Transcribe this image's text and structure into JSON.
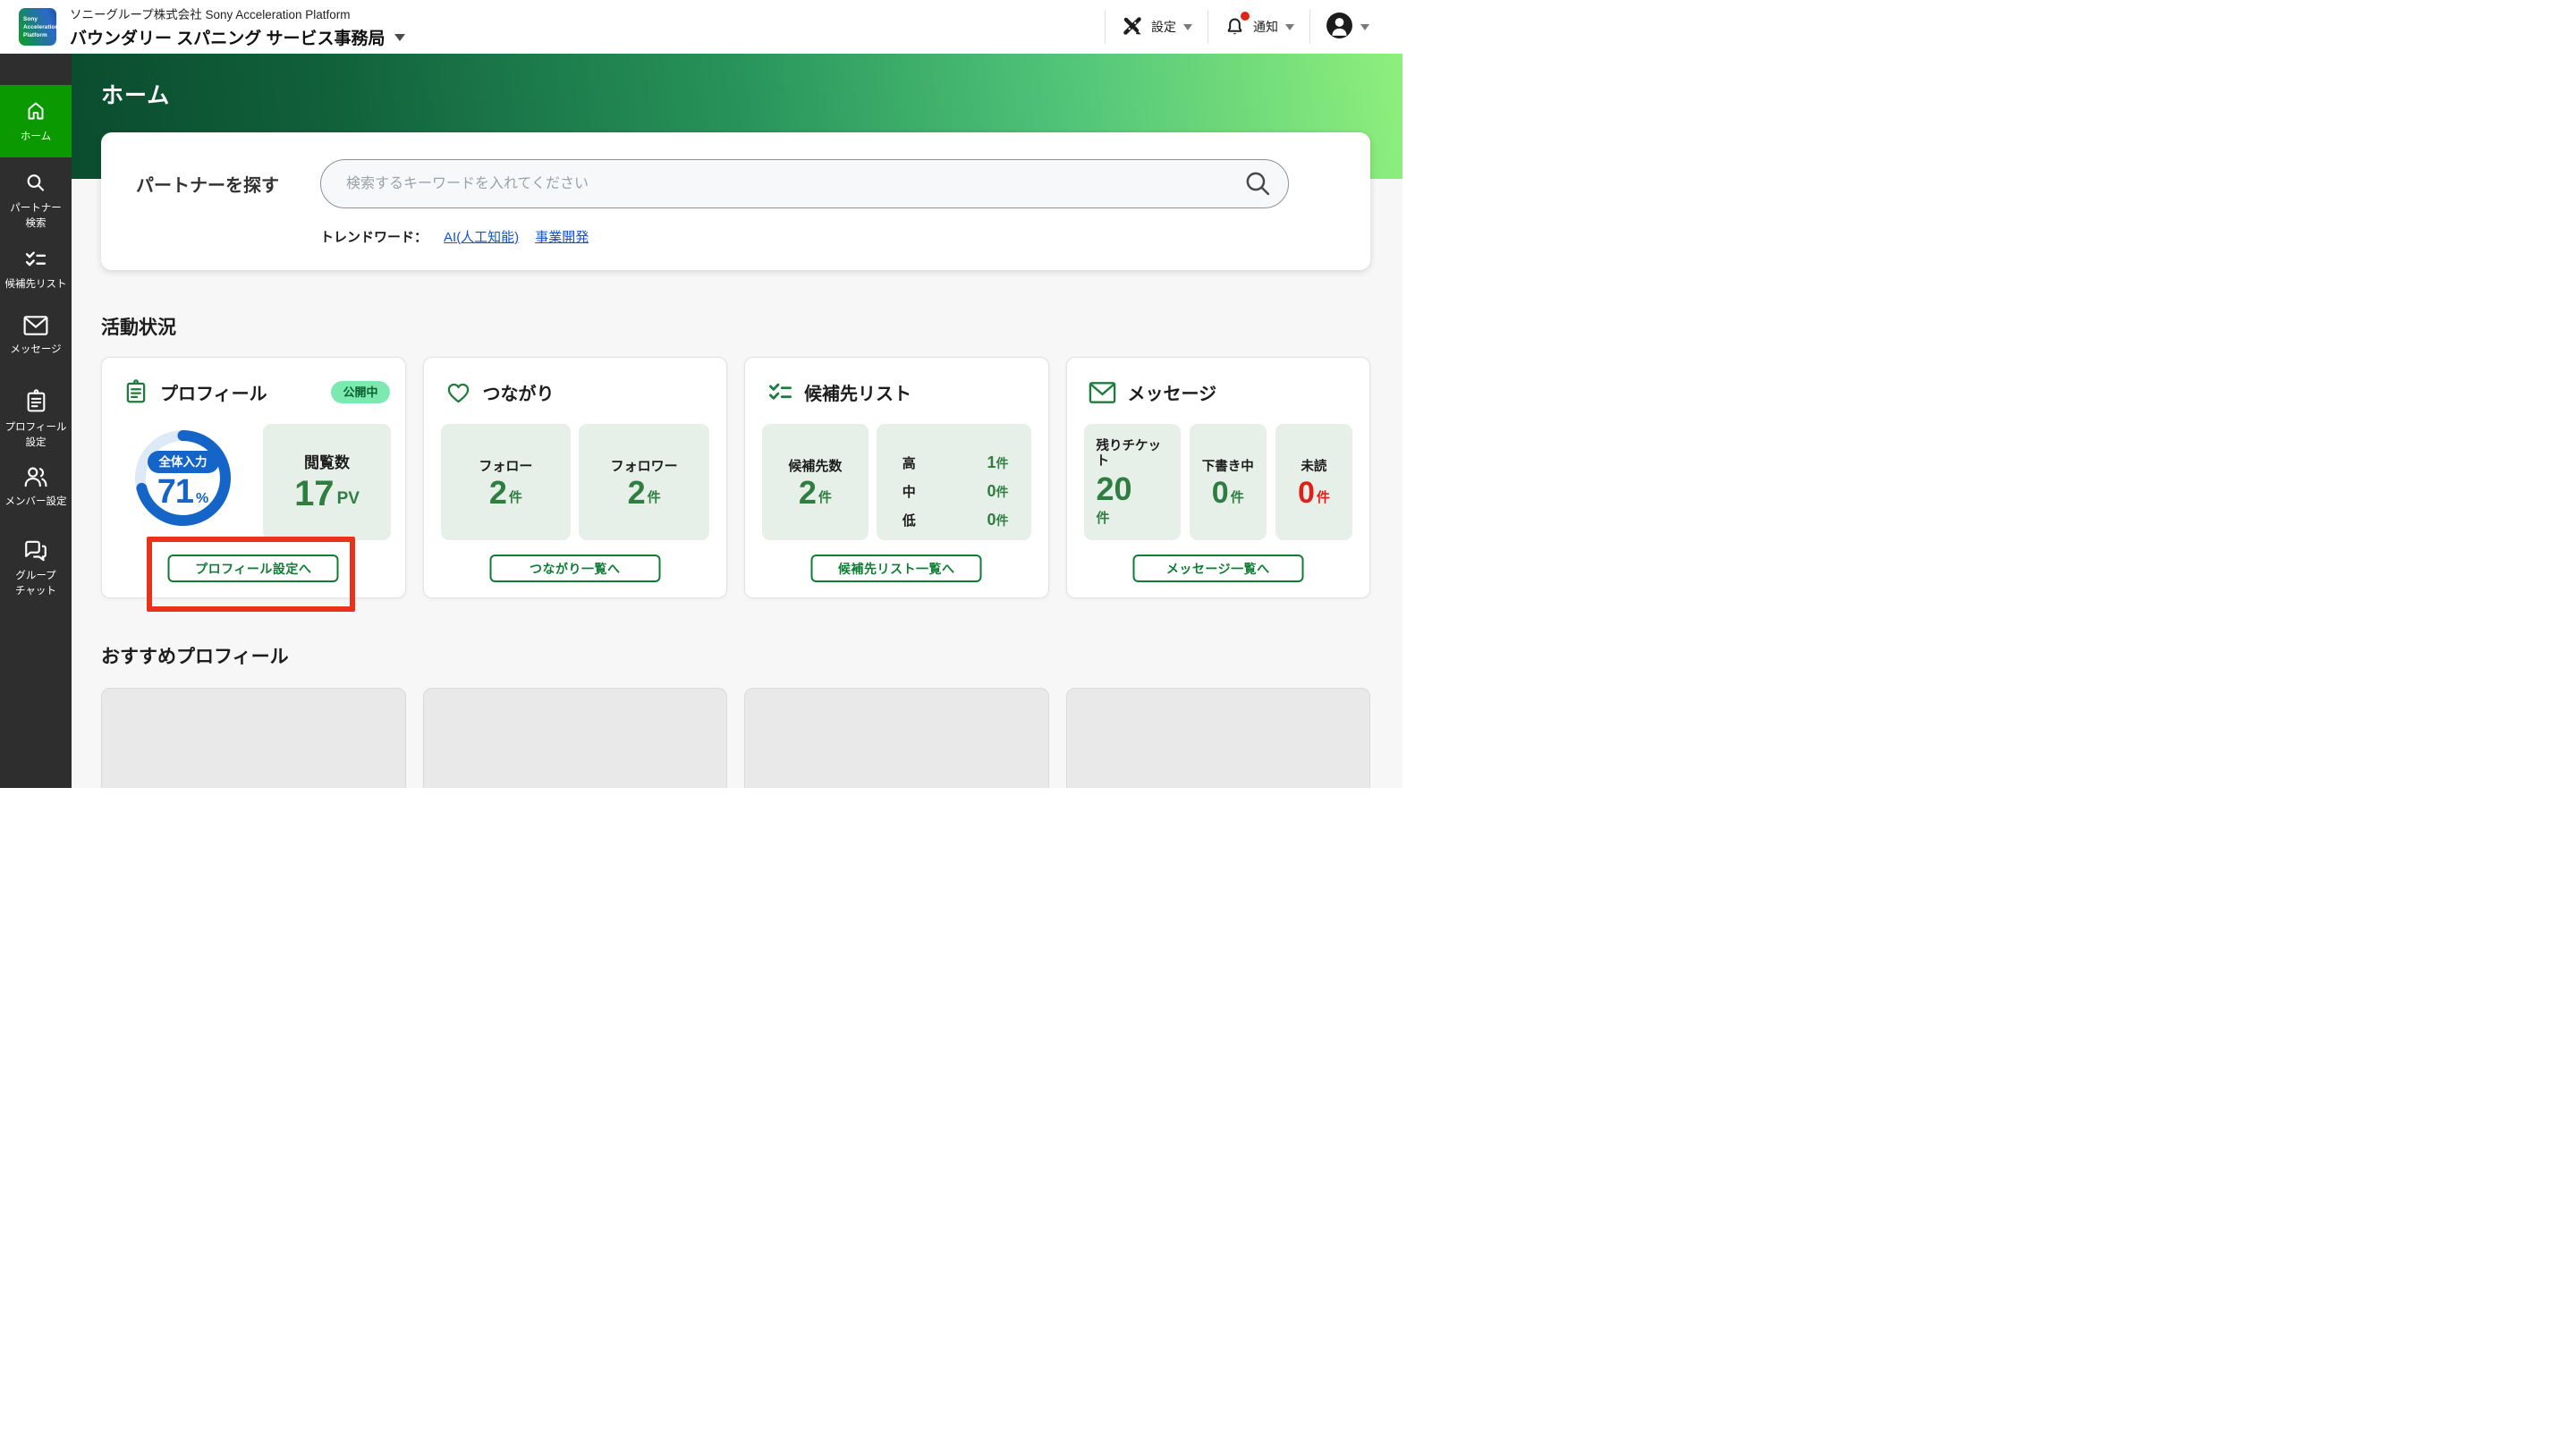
{
  "colors": {
    "active_nav_green": "#0a9900",
    "accent_green": "#0e7c34",
    "number_green": "#2e7d41",
    "progress_blue": "#1565c8",
    "alert_red": "#dc2119",
    "annotation_red": "#e8331a",
    "link_blue": "#1454c8",
    "badge_bg": "#7ceab0",
    "hero_gradient_start": "#0a4c2e",
    "hero_gradient_end": "#8eef7c"
  },
  "header": {
    "logo_lines": [
      "Sony",
      "Acceleration",
      "Platform"
    ],
    "company": "ソニーグループ株式会社 Sony Acceleration Platform",
    "org": "バウンダリー スパニング サービス事務局",
    "settings": "設定",
    "notifications": "通知"
  },
  "sidebar": {
    "items": [
      {
        "id": "home",
        "lines": [
          "ホーム"
        ],
        "active": true
      },
      {
        "id": "partner-search",
        "lines": [
          "パートナー",
          "検索"
        ]
      },
      {
        "id": "candidate-list",
        "lines": [
          "候補先リスト"
        ]
      },
      {
        "id": "messages",
        "lines": [
          "メッセージ"
        ]
      },
      {
        "id": "profile-settings",
        "lines": [
          "プロフィール",
          "設定"
        ]
      },
      {
        "id": "member-settings",
        "lines": [
          "メンバー設定"
        ]
      },
      {
        "id": "group-chat",
        "lines": [
          "グループ",
          "チャット"
        ]
      }
    ]
  },
  "hero": {
    "title": "ホーム"
  },
  "search": {
    "label": "パートナーを探す",
    "placeholder": "検索するキーワードを入れてください",
    "trend_label": "トレンドワード：",
    "trend_links": [
      "AI(人工知能)",
      "事業開発"
    ]
  },
  "activity": {
    "title": "活動状況",
    "profile": {
      "title": "プロフィール",
      "badge": "公開中",
      "ring_label": "全体入力",
      "percent": "71",
      "percent_unit": "%",
      "views_label": "閲覧数",
      "views_value": "17",
      "views_unit": "PV",
      "button": "プロフィール設定へ"
    },
    "connections": {
      "title": "つながり",
      "stats": [
        {
          "label": "フォロー",
          "value": "2",
          "unit": "件"
        },
        {
          "label": "フォロワー",
          "value": "2",
          "unit": "件"
        }
      ],
      "button": "つながり一覧へ"
    },
    "candidates": {
      "title": "候補先リスト",
      "count_label": "候補先数",
      "count_value": "2",
      "count_unit": "件",
      "priorities": [
        {
          "label": "高",
          "value": "1",
          "unit": "件"
        },
        {
          "label": "中",
          "value": "0",
          "unit": "件"
        },
        {
          "label": "低",
          "value": "0",
          "unit": "件"
        }
      ],
      "button": "候補先リスト一覧へ"
    },
    "messages": {
      "title": "メッセージ",
      "tickets_label": "残りチケット",
      "tickets_value": "20",
      "tickets_unit": "件",
      "drafts_label": "下書き中",
      "drafts_value": "0",
      "drafts_unit": "件",
      "unread_label": "未読",
      "unread_value": "0",
      "unread_unit": "件",
      "button": "メッセージ一覧へ"
    }
  },
  "recommended": {
    "title": "おすすめプロフィール"
  }
}
